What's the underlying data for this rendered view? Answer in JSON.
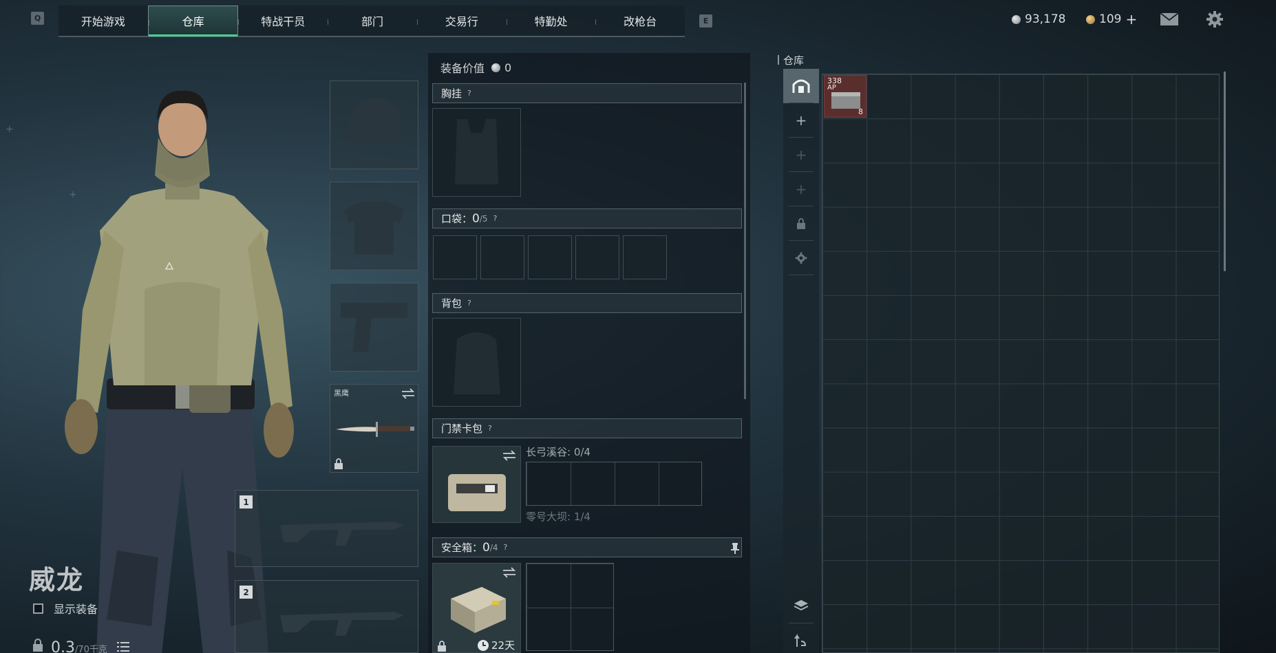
{
  "nav": {
    "key_left": "Q",
    "key_right": "E",
    "tabs": [
      {
        "label": "开始游戏",
        "active": false
      },
      {
        "label": "仓库",
        "active": true
      },
      {
        "label": "特战干员",
        "active": false
      },
      {
        "label": "部门",
        "active": false
      },
      {
        "label": "交易行",
        "active": false
      },
      {
        "label": "特勤处",
        "active": false
      },
      {
        "label": "改枪台",
        "active": false
      }
    ]
  },
  "currency": {
    "silver": "93,178",
    "gold": "109",
    "gold_add": "+"
  },
  "operator": {
    "name": "威龙",
    "show_gear_label": "显示装备",
    "weight_current": "0.3",
    "weight_max": "/70千克"
  },
  "gear": {
    "melee_label": "黑鹰",
    "weapon1_num": "1",
    "weapon2_num": "2"
  },
  "equipment": {
    "value_label": "装备价值",
    "value": "0",
    "chest_rig": "胸挂",
    "pocket_label": "口袋：",
    "pocket_current": "0",
    "pocket_max": "/5",
    "backpack": "背包",
    "keycard_label": "门禁卡包",
    "keycard_map1": "长弓溪谷: 0/4",
    "keycard_map2": "零号大坝: 1/4",
    "safebox_label": "安全箱：",
    "safebox_current": "0",
    "safebox_max": "/4",
    "safebox_time": "22天",
    "help": "?"
  },
  "warehouse": {
    "title": "仓库",
    "item": {
      "top": "338",
      "mid": "AP",
      "count": "8"
    }
  },
  "colors": {
    "accent_green": "#4ccd95",
    "ammo_red": "#5b2e2e"
  }
}
